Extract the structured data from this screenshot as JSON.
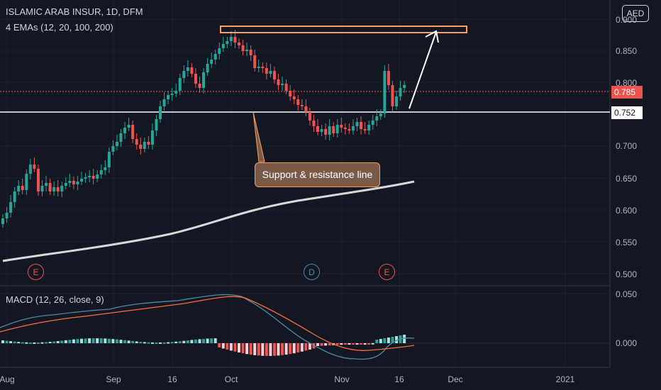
{
  "header": {
    "symbol_line": "ISLAMIC ARAB INSUR, 1D, DFM",
    "ema_line": "4 EMAs (12, 20, 100, 200)",
    "currency": "AED"
  },
  "price_axis": {
    "ticks": [
      "0.900",
      "0.850",
      "0.800",
      "0.750",
      "0.700",
      "0.650",
      "0.600",
      "0.550",
      "0.500"
    ],
    "last_price_label": "0.785",
    "support_price_label": "0.752"
  },
  "macd": {
    "legend": "MACD (12, 26, close, 9)",
    "ticks": [
      "0.050",
      "0.000"
    ]
  },
  "time_axis": {
    "labels": [
      "Aug",
      "Sep",
      "16",
      "Oct",
      "Nov",
      "16",
      "Dec",
      "2021"
    ]
  },
  "annotations": {
    "callout_text": "Support & resistance line"
  },
  "event_markers": [
    {
      "label": "E",
      "kind": "earnings"
    },
    {
      "label": "D",
      "kind": "dividend"
    },
    {
      "label": "E",
      "kind": "earnings"
    }
  ],
  "colors": {
    "background": "#131722",
    "up": "#26a69a",
    "down": "#ef5350",
    "annotation": "#ff9d5c",
    "ema_long": "#d9d9d9"
  }
}
